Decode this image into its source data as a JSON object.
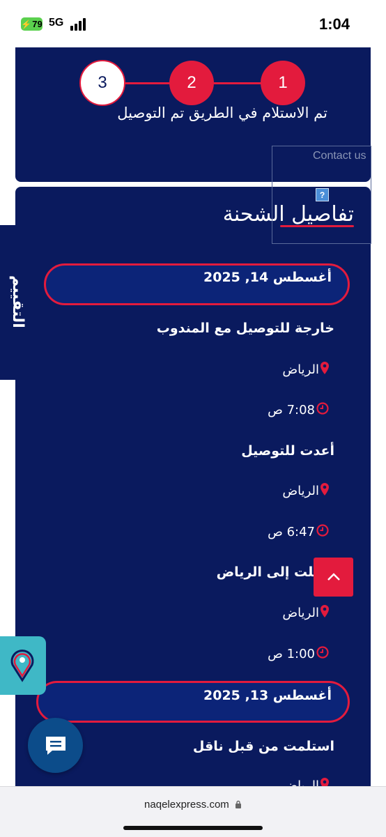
{
  "status_bar": {
    "time": "1:04",
    "battery": "79",
    "network": "5G"
  },
  "progress": {
    "steps": [
      "1",
      "2",
      "3"
    ],
    "labels": "تم الاستلام  في الطريق  تم التوصيل",
    "current_step": 3
  },
  "contact": {
    "label": "Contact us",
    "icon": "?"
  },
  "details": {
    "title": "تفاصيل الشحنة",
    "groups": [
      {
        "date": "أغسطس 14, 2025",
        "events": [
          {
            "status": "خارجة للتوصيل مع المندوب",
            "location": "الرياض",
            "time": "7:08 ص"
          },
          {
            "status": "أعدت للتوصيل",
            "location": "الرياض",
            "time": "6:47 ص"
          },
          {
            "status": "وصلت إلى الرياض",
            "location": "الرياض",
            "time": "1:00 ص"
          }
        ]
      },
      {
        "date": "أغسطس 13, 2025",
        "events": [
          {
            "status": "استلمت من قبل ناقل",
            "location": "الرياض"
          }
        ]
      }
    ]
  },
  "rating_tab": {
    "label": "التقييم"
  },
  "icons": {
    "location": "map-pin-icon",
    "time": "clock-icon",
    "scroll_top": "chevron-up-icon",
    "chat": "chat-bubble-icon",
    "lock": "lock-icon"
  },
  "colors": {
    "navy": "#0a1a5e",
    "accent_red": "#e31b3d",
    "teal": "#3fb8c6",
    "chat_blue": "#0c4c8a"
  },
  "browser": {
    "url": "naqelexpress.com"
  }
}
